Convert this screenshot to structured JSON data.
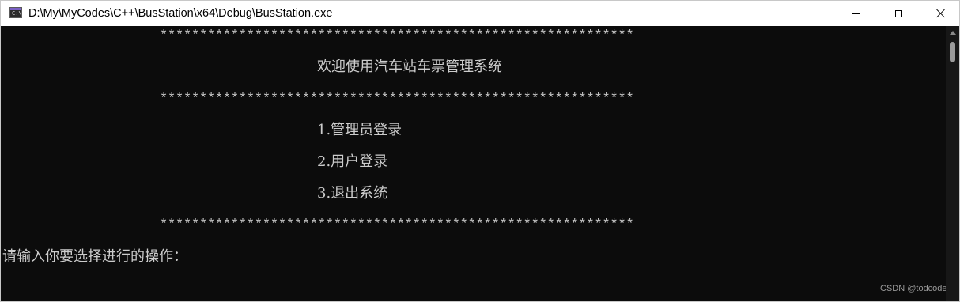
{
  "window": {
    "title": "D:\\My\\MyCodes\\C++\\BusStation\\x64\\Debug\\BusStation.exe",
    "icon": "console-app-icon",
    "icon_glyph": "C:\\",
    "controls": {
      "minimize": "minimize-icon",
      "maximize": "maximize-icon",
      "close": "close-icon"
    }
  },
  "console": {
    "divider": "************************************************************",
    "title": "欢迎使用汽车站车票管理系统",
    "menu": [
      "1.管理员登录",
      "2.用户登录",
      "3.退出系统"
    ],
    "prompt": "请输入你要选择进行的操作："
  },
  "watermark": "CSDN @todcode",
  "colors": {
    "console_bg": "#0c0c0c",
    "console_text": "#cccccc",
    "titlebar_bg": "#ffffff"
  }
}
